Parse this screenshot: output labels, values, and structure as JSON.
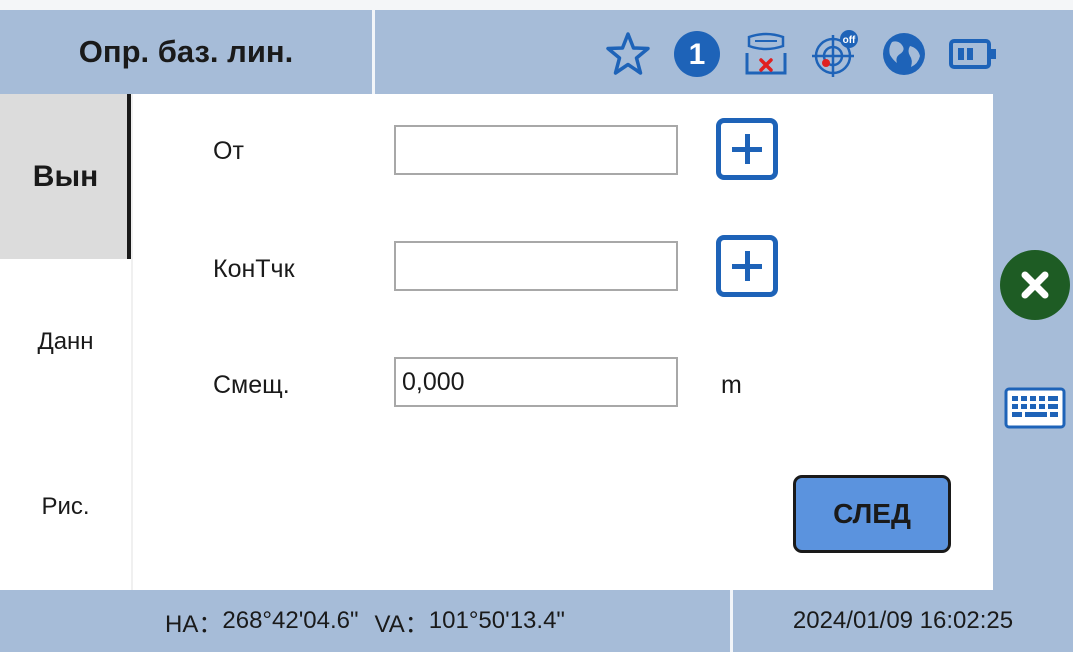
{
  "header": {
    "title": "Опр. баз. лин.",
    "status_icons": [
      "star-icon",
      "solution-number-icon",
      "network-disconnected-icon",
      "laser-off-icon",
      "globe-icon",
      "battery-icon"
    ],
    "solution_number": "1",
    "laser_badge": "off"
  },
  "sidebar": {
    "tabs": [
      {
        "label": "Вын",
        "active": true
      },
      {
        "label": "Данн",
        "active": false
      },
      {
        "label": "Рис.",
        "active": false
      }
    ]
  },
  "form": {
    "from_label": "От",
    "from_value": "",
    "end_label": "КонТчк",
    "end_value": "",
    "offset_label": "Смещ.",
    "offset_value": "0,000",
    "offset_unit": "m",
    "next_label": "СЛЕД"
  },
  "footer": {
    "ha_label": "HA：",
    "ha_value": "268°42'04.6\"",
    "va_label": "VA：",
    "va_value": "101°50'13.4\"",
    "datetime": "2024/01/09 16:02:25"
  },
  "colors": {
    "frame": "#a6bcd8",
    "accent": "#1e63b8",
    "button": "#5b93de",
    "close": "#1e5c24"
  }
}
